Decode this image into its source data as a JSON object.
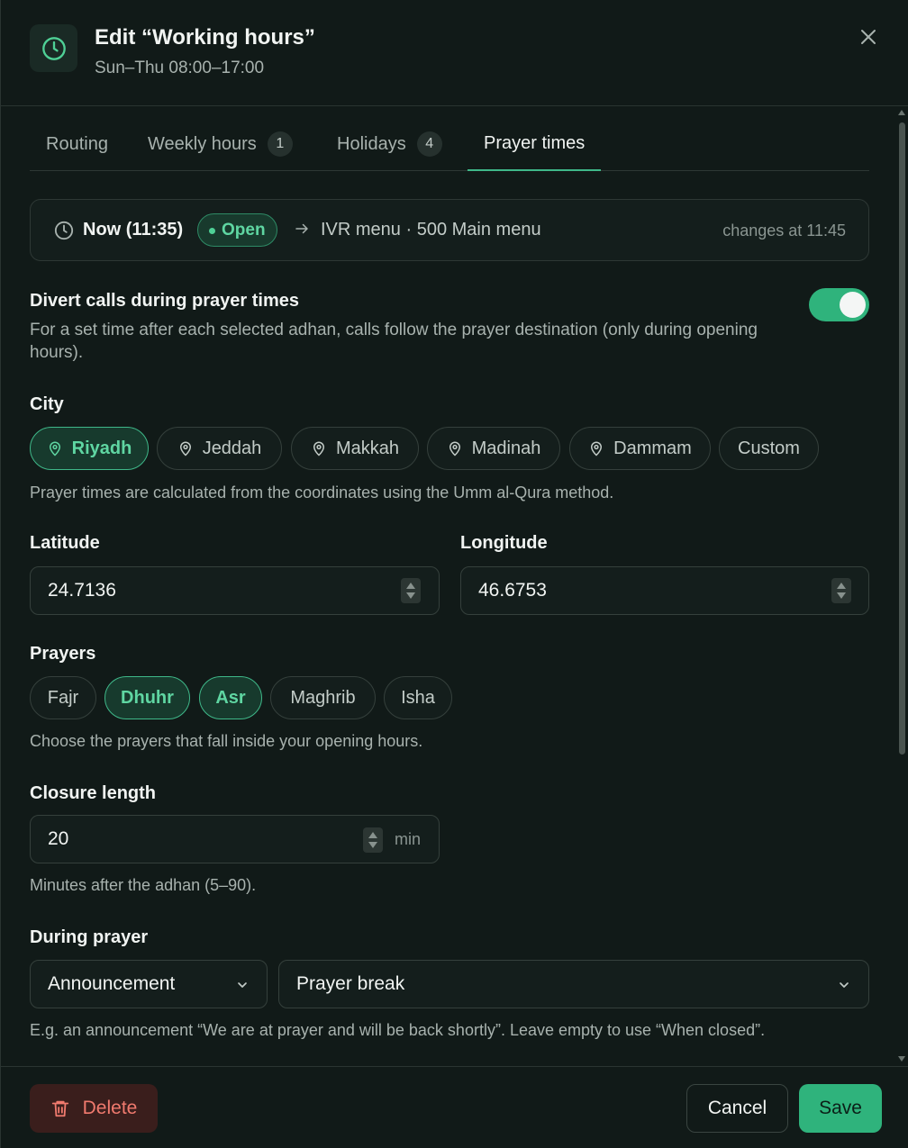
{
  "header": {
    "title": "Edit “Working hours”",
    "subtitle": "Sun–Thu 08:00–17:00"
  },
  "tabs": [
    {
      "label": "Routing",
      "badge": null
    },
    {
      "label": "Weekly hours",
      "badge": "1"
    },
    {
      "label": "Holidays",
      "badge": "4"
    },
    {
      "label": "Prayer times",
      "badge": null,
      "active": true
    }
  ],
  "status": {
    "now": "Now (11:35)",
    "state": "Open",
    "destination": "IVR menu · 500 Main menu",
    "changes": "changes at 11:45"
  },
  "divert": {
    "title": "Divert calls during prayer times",
    "description": "For a set time after each selected adhan, calls follow the prayer destination (only during opening hours).",
    "enabled": true
  },
  "city": {
    "label": "City",
    "options": [
      "Riyadh",
      "Jeddah",
      "Makkah",
      "Madinah",
      "Dammam",
      "Custom"
    ],
    "selected": "Riyadh",
    "help": "Prayer times are calculated from the coordinates using the Umm al-Qura method."
  },
  "coordinates": {
    "latitude_label": "Latitude",
    "latitude": "24.7136",
    "longitude_label": "Longitude",
    "longitude": "46.6753"
  },
  "prayers": {
    "label": "Prayers",
    "options": [
      "Fajr",
      "Dhuhr",
      "Asr",
      "Maghrib",
      "Isha"
    ],
    "selected": [
      "Dhuhr",
      "Asr"
    ],
    "help": "Choose the prayers that fall inside your opening hours."
  },
  "closure": {
    "label": "Closure length",
    "value": "20",
    "unit": "min",
    "help": "Minutes after the adhan (5–90)."
  },
  "during_prayer": {
    "label": "During prayer",
    "type": "Announcement",
    "destination": "Prayer break",
    "help": "E.g. an announcement “We are at prayer and will be back shortly”. Leave empty to use “When closed”."
  },
  "footer": {
    "delete": "Delete",
    "cancel": "Cancel",
    "save": "Save"
  },
  "colors": {
    "accent": "#2fb37c",
    "background": "#111a18",
    "danger": "#f07a6e"
  }
}
